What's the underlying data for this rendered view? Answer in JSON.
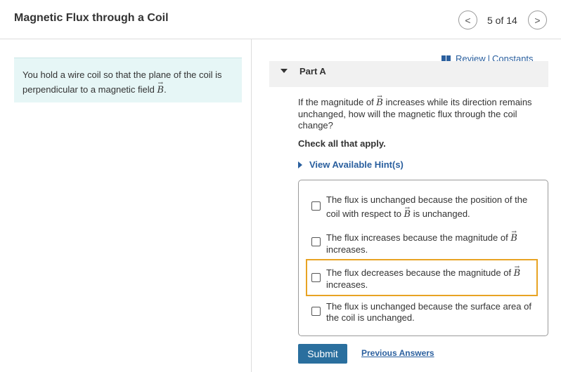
{
  "header": {
    "title": "Magnetic Flux through a Coil",
    "counter": "5 of 14",
    "prev_glyph": "<",
    "next_glyph": ">"
  },
  "intro": {
    "text_before": "You hold a wire coil so that the plane of the coil is perpendicular to a magnetic field ",
    "symbol": "B",
    "text_after": "."
  },
  "links": {
    "review": "Review",
    "separator": "|",
    "constants": "Constants"
  },
  "part": {
    "label": "Part A",
    "question_before": "If the magnitude of ",
    "question_symbol": "B",
    "question_after": " increases while its direction remains unchanged, how will the magnetic flux through the coil change?",
    "instruction": "Check all that apply.",
    "hint_label": "View Available Hint(s)"
  },
  "options": [
    {
      "before": "The flux is unchanged because the position of the coil with respect to ",
      "symbol": "B",
      "after": " is unchanged.",
      "checked": false
    },
    {
      "before": "The flux increases because the magnitude of ",
      "symbol": "B",
      "after": " increases.",
      "checked": false
    },
    {
      "before": "The flux decreases because the magnitude of ",
      "symbol": "B",
      "after": " increases.",
      "checked": false,
      "highlighted": true
    },
    {
      "before": "The flux is unchanged because the surface area of the coil is unchanged.",
      "symbol": "",
      "after": "",
      "checked": false
    }
  ],
  "actions": {
    "submit_label": "Submit",
    "previous_answers_label": "Previous Answers"
  },
  "colors": {
    "accent": "#2a5f9e",
    "submit_bg": "#2a6f9e",
    "intro_bg": "#e6f6f6",
    "highlight": "#e8a323"
  }
}
